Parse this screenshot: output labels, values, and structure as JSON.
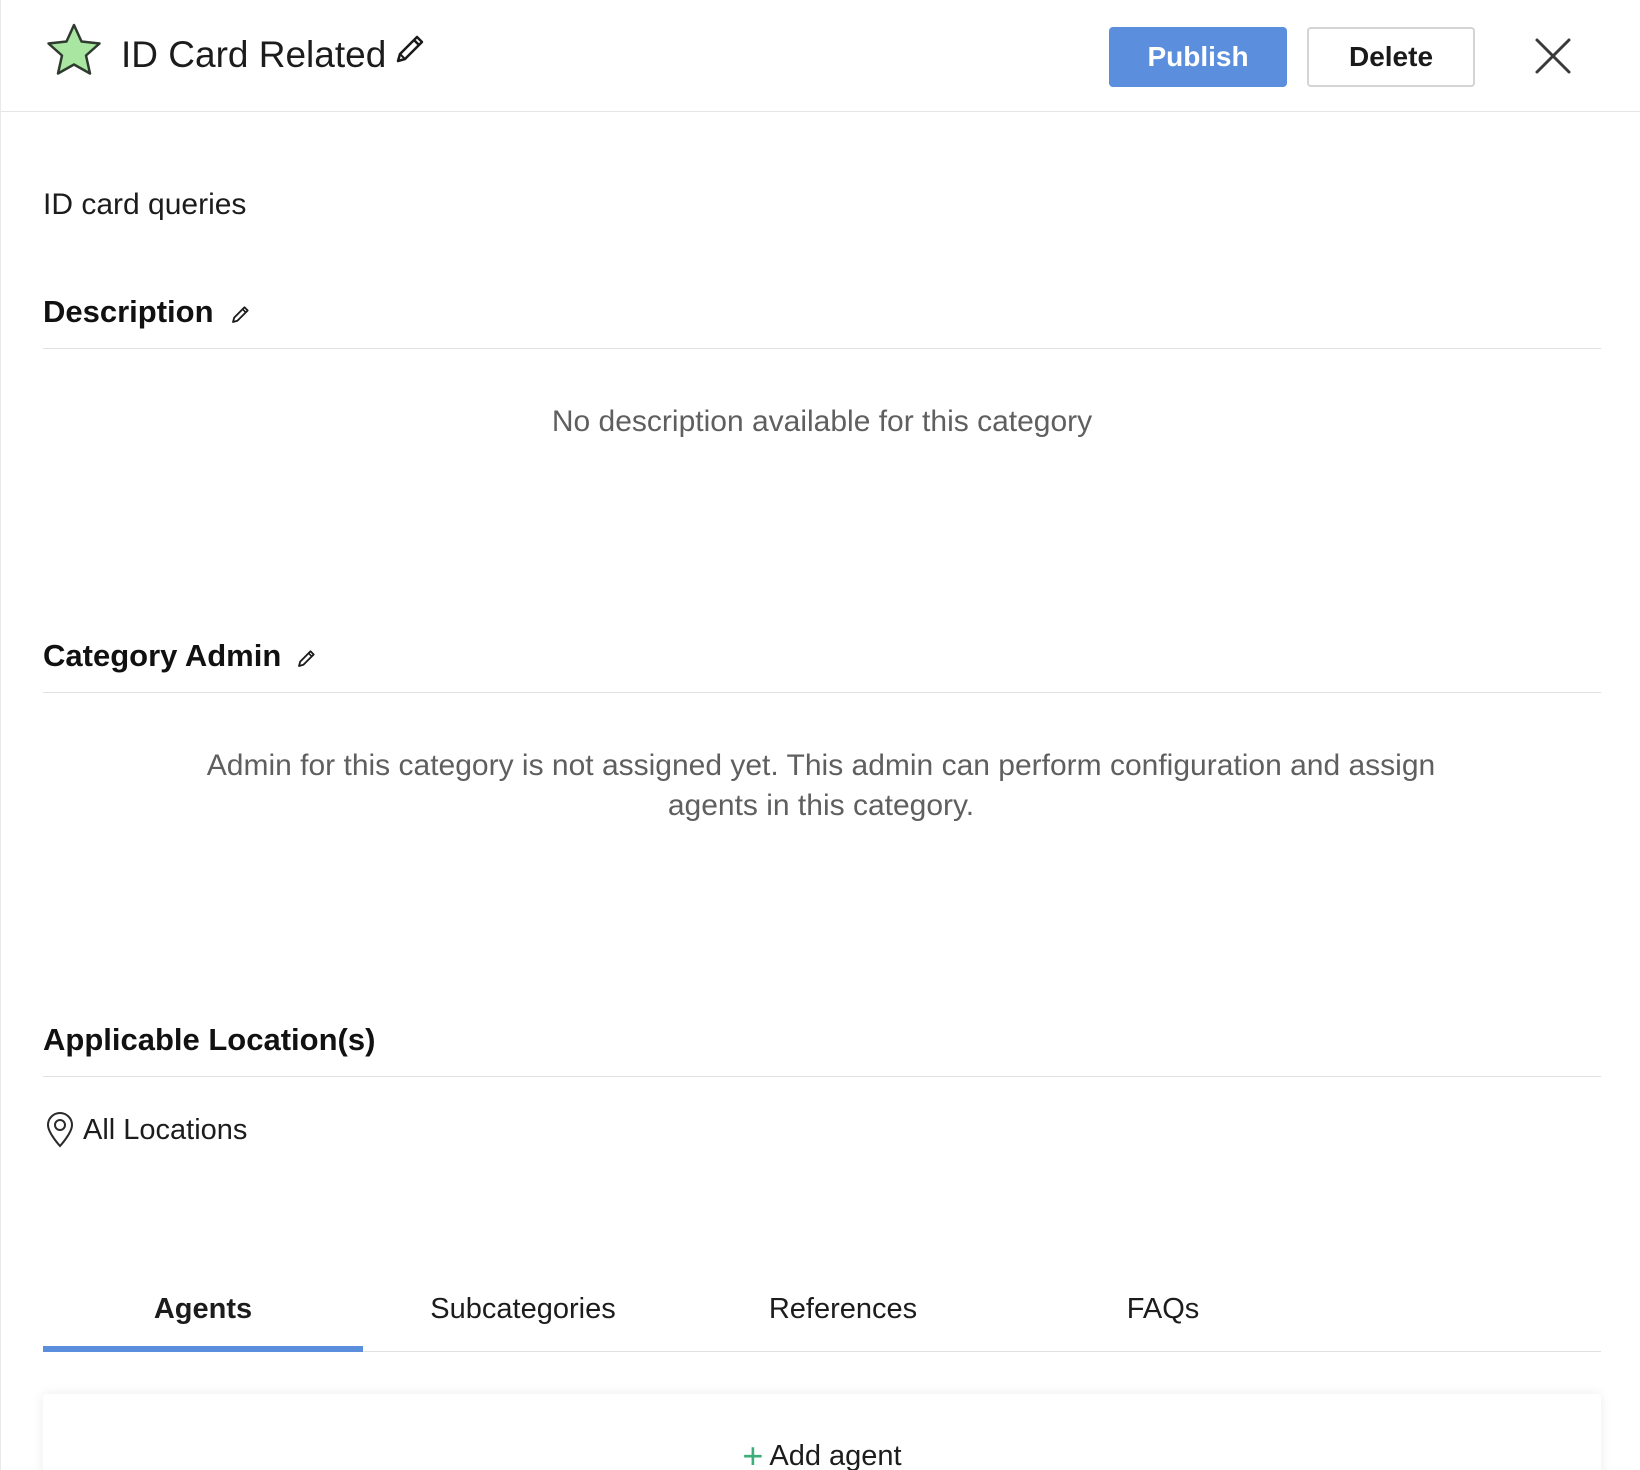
{
  "header": {
    "title": "ID Card Related",
    "publish_label": "Publish",
    "delete_label": "Delete",
    "star_icon": "star-icon",
    "edit_icon": "pencil-icon",
    "close_icon": "close-icon"
  },
  "category": {
    "summary": "ID card queries"
  },
  "description": {
    "title": "Description",
    "empty_text": "No description available for this category"
  },
  "category_admin": {
    "title": "Category Admin",
    "empty_text": "Admin for this category is not assigned yet. This admin can perform configuration and assign agents in this category."
  },
  "locations": {
    "title": "Applicable Location(s)",
    "value": "All Locations",
    "icon": "location-pin-icon"
  },
  "tabs": [
    {
      "label": "Agents",
      "active": true
    },
    {
      "label": "Subcategories",
      "active": false
    },
    {
      "label": "References",
      "active": false
    },
    {
      "label": "FAQs",
      "active": false
    }
  ],
  "agents_panel": {
    "add_label": "Add agent",
    "add_icon": "plus-icon"
  },
  "colors": {
    "primary": "#5b8fde",
    "star_fill": "#a9e6a2",
    "plus_accent": "#3cae7a",
    "muted_text": "#5f5f5f"
  }
}
